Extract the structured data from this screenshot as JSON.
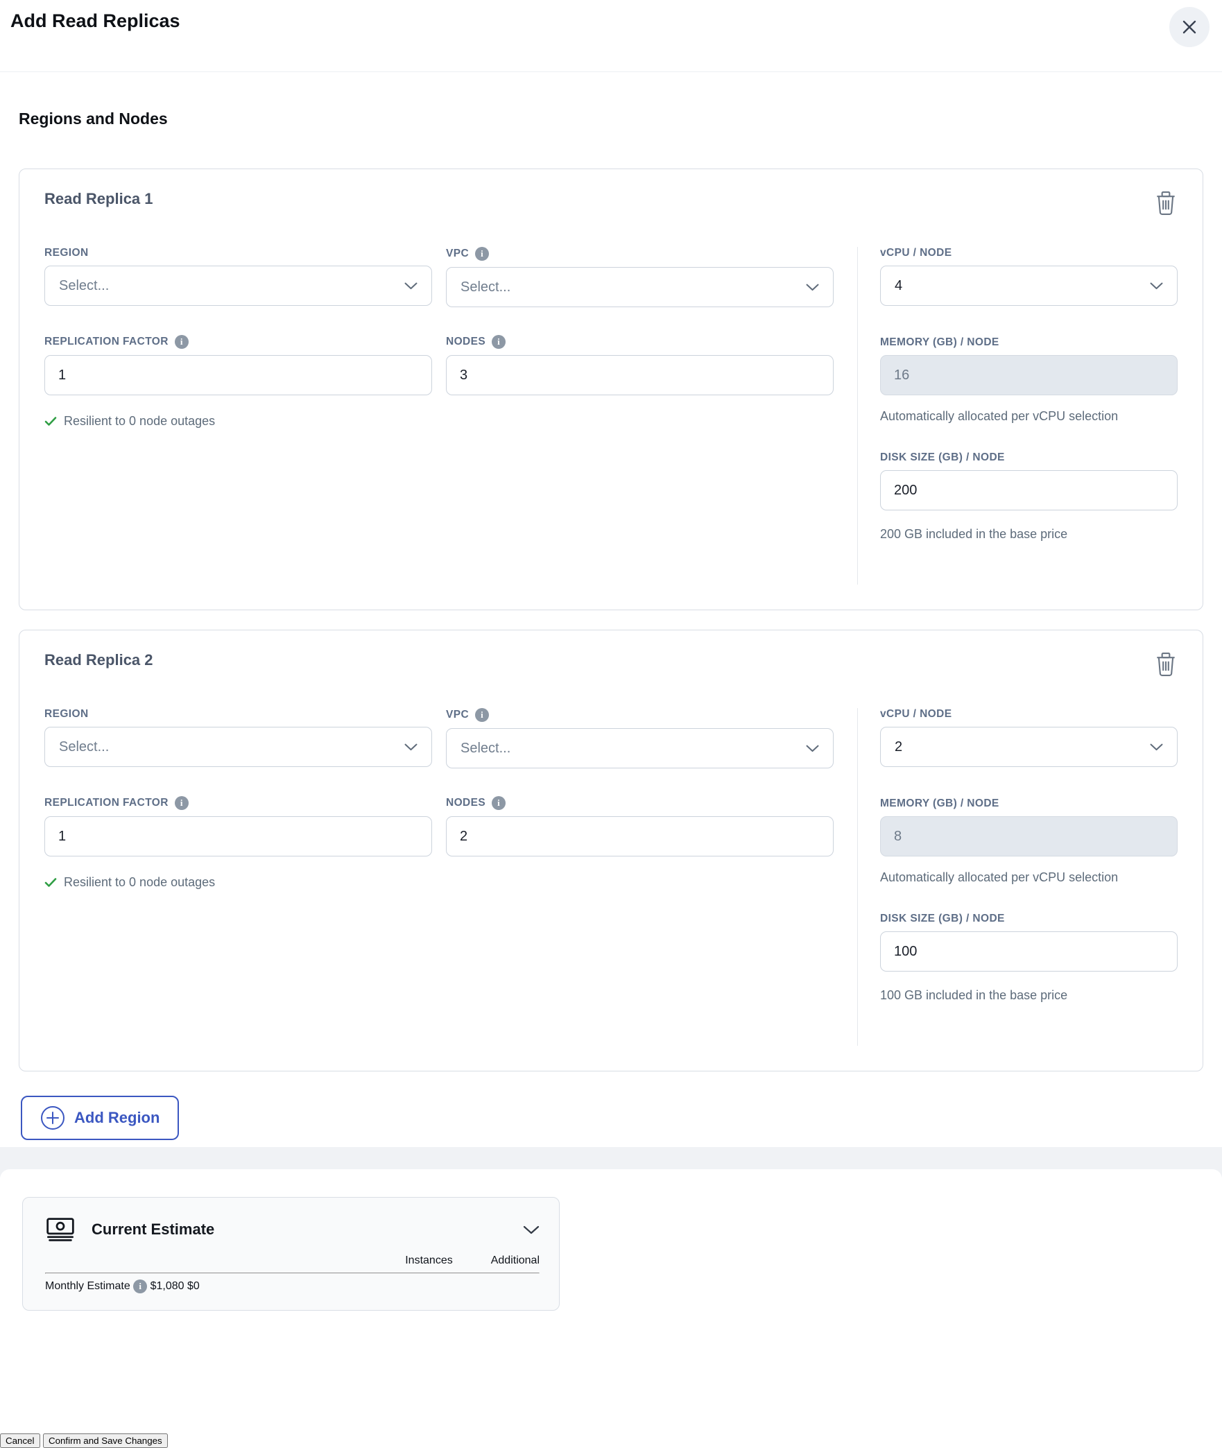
{
  "dialog": {
    "title": "Add Read Replicas",
    "section_title": "Regions and Nodes"
  },
  "labels": {
    "region": "REGION",
    "vpc": "VPC",
    "vcpu": "vCPU / NODE",
    "replication_factor": "REPLICATION FACTOR",
    "nodes": "NODES",
    "memory": "MEMORY (GB) / NODE",
    "disk": "DISK SIZE (GB) / NODE",
    "memory_note": "Automatically allocated per vCPU selection"
  },
  "replicas": [
    {
      "title": "Read Replica 1",
      "region_value": "Select...",
      "vpc_value": "Select...",
      "vcpu_value": "4",
      "replication_factor": "1",
      "nodes": "3",
      "memory": "16",
      "disk": "200",
      "resilience_note": "Resilient to 0 node outages",
      "disk_note": "200 GB included in the base price"
    },
    {
      "title": "Read Replica 2",
      "region_value": "Select...",
      "vpc_value": "Select...",
      "vcpu_value": "2",
      "replication_factor": "1",
      "nodes": "2",
      "memory": "8",
      "disk": "100",
      "resilience_note": "Resilient to 0 node outages",
      "disk_note": "100 GB included in the base price"
    }
  ],
  "add_region_label": "Add Region",
  "estimate": {
    "title": "Current Estimate",
    "col_instances": "Instances",
    "col_additional": "Additional",
    "row_label": "Monthly Estimate",
    "instances_value": "$1,080",
    "additional_value": "$0"
  },
  "footer": {
    "cancel": "Cancel",
    "confirm": "Confirm and Save Changes"
  },
  "colors": {
    "accent": "#3b57c1",
    "confirm_button": "#3d58bc",
    "success_check": "#2f9e44"
  }
}
